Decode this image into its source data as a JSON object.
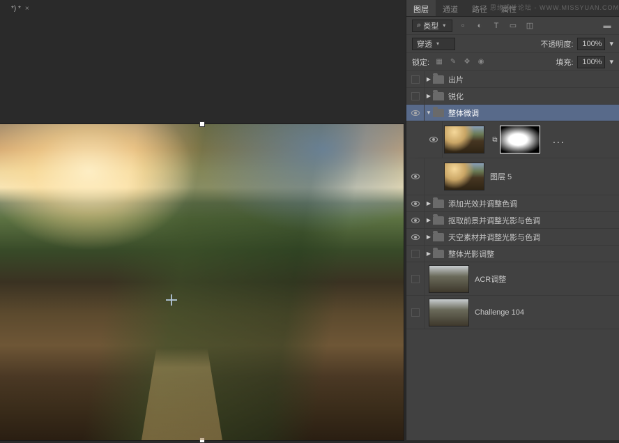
{
  "tab": {
    "label": "*) *",
    "close": "×"
  },
  "panel": {
    "tabs": {
      "layers": "图层",
      "channels": "通道",
      "paths": "路径",
      "properties": "属性"
    },
    "watermark": "思缘设计论坛 - WWW.MISSYUAN.COM"
  },
  "filterRow": {
    "search_icon": "⌕",
    "type_label": "类型",
    "icons": [
      "▫",
      "◐",
      "T",
      "▭",
      "◫",
      "▬"
    ]
  },
  "blendRow": {
    "mode": "穿透",
    "opacity_label": "不透明度:",
    "opacity_value": "100%"
  },
  "lockRow": {
    "lock_label": "锁定:",
    "fill_label": "填充:",
    "fill_value": "100%",
    "lock_icons": [
      "▦",
      "✎",
      "✥",
      "◉"
    ]
  },
  "layers": [
    {
      "name": "出片",
      "type": "group",
      "expanded": false,
      "visible": false
    },
    {
      "name": "锐化",
      "type": "group",
      "expanded": false,
      "visible": false
    },
    {
      "name": "整体微调",
      "type": "group",
      "expanded": true,
      "visible": true,
      "selected": true
    },
    {
      "name": "图层 5",
      "type": "layer",
      "visible": true
    },
    {
      "name": "添加光效并调整色调",
      "type": "group",
      "expanded": false,
      "visible": true
    },
    {
      "name": "抠取前景并调整光影与色调",
      "type": "group",
      "expanded": false,
      "visible": true
    },
    {
      "name": "天空素材并调整光影与色调",
      "type": "group",
      "expanded": false,
      "visible": true
    },
    {
      "name": "整体光影调整",
      "type": "group",
      "expanded": false,
      "visible": false
    },
    {
      "name": "ACR调整",
      "type": "layer-big",
      "visible": false
    },
    {
      "name": "Challenge 104",
      "type": "layer-big",
      "visible": false
    }
  ],
  "caret": "▾",
  "tri_right": "▶",
  "tri_down": "▼",
  "ellipsis": "..."
}
